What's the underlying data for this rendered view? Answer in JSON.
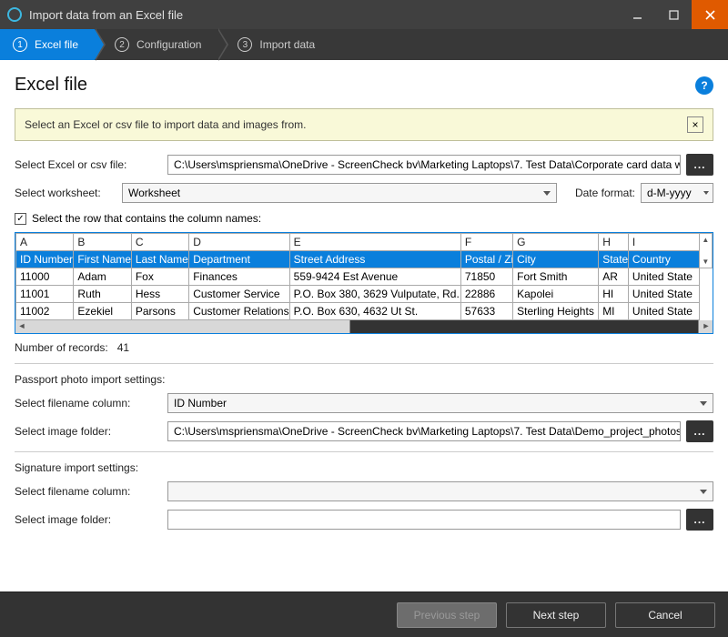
{
  "window": {
    "title": "Import data from an Excel file"
  },
  "steps": {
    "s1": "Excel file",
    "s2": "Configuration",
    "s3": "Import data"
  },
  "heading": "Excel file",
  "help": "?",
  "banner": {
    "msg": "Select an Excel or csv file to import data and images from.",
    "close": "×"
  },
  "file_row": {
    "label": "Select Excel or csv file:",
    "value": "C:\\Users\\mspriensma\\OneDrive - ScreenCheck bv\\Marketing Laptops\\7. Test Data\\Corporate card data with phot",
    "browse": "..."
  },
  "ws_row": {
    "label": "Select worksheet:",
    "value": "Worksheet",
    "date_label": "Date format:",
    "date_value": "d-M-yyyy"
  },
  "check_row": {
    "label": "Select the row that contains the column names:",
    "checked": "✓"
  },
  "grid": {
    "letters": [
      "A",
      "B",
      "C",
      "D",
      "E",
      "F",
      "G",
      "H",
      "I"
    ],
    "cols": [
      "ID Number",
      "First Name",
      "Last Name",
      "Department",
      "Street Address",
      "Postal / Zip",
      "City",
      "State",
      "Country"
    ],
    "rows": [
      [
        "11000",
        "Adam",
        "Fox",
        "Finances",
        "559-9424 Est Avenue",
        "71850",
        "Fort Smith",
        "AR",
        "United State"
      ],
      [
        "11001",
        "Ruth",
        "Hess",
        "Customer Service",
        "P.O. Box 380, 3629 Vulputate, Rd.",
        "22886",
        "Kapolei",
        "HI",
        "United State"
      ],
      [
        "11002",
        "Ezekiel",
        "Parsons",
        "Customer Relations",
        "P.O. Box 630, 4632 Ut St.",
        "57633",
        "Sterling Heights",
        "MI",
        "United State"
      ]
    ],
    "widths": [
      62,
      62,
      62,
      108,
      184,
      56,
      92,
      32,
      76
    ]
  },
  "records": {
    "label": "Number of records:",
    "value": "41"
  },
  "passport": {
    "title": "Passport photo import settings:",
    "col_label": "Select filename column:",
    "col_value": "ID Number",
    "folder_label": "Select image folder:",
    "folder_value": "C:\\Users\\mspriensma\\OneDrive - ScreenCheck bv\\Marketing Laptops\\7. Test Data\\Demo_project_photos",
    "browse": "..."
  },
  "signature": {
    "title": "Signature import settings:",
    "col_label": "Select filename column:",
    "col_value": "",
    "folder_label": "Select image folder:",
    "folder_value": "",
    "browse": "..."
  },
  "footer": {
    "prev": "Previous step",
    "next": "Next step",
    "cancel": "Cancel"
  }
}
